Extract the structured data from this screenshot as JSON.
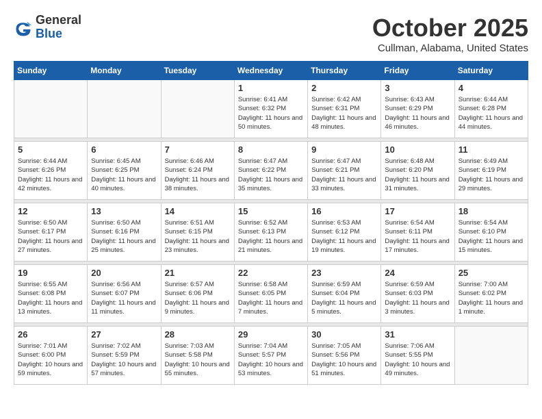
{
  "header": {
    "logo_general": "General",
    "logo_blue": "Blue",
    "month": "October 2025",
    "location": "Cullman, Alabama, United States"
  },
  "weekdays": [
    "Sunday",
    "Monday",
    "Tuesday",
    "Wednesday",
    "Thursday",
    "Friday",
    "Saturday"
  ],
  "weeks": [
    [
      {
        "day": "",
        "detail": ""
      },
      {
        "day": "",
        "detail": ""
      },
      {
        "day": "",
        "detail": ""
      },
      {
        "day": "1",
        "detail": "Sunrise: 6:41 AM\nSunset: 6:32 PM\nDaylight: 11 hours\nand 50 minutes."
      },
      {
        "day": "2",
        "detail": "Sunrise: 6:42 AM\nSunset: 6:31 PM\nDaylight: 11 hours\nand 48 minutes."
      },
      {
        "day": "3",
        "detail": "Sunrise: 6:43 AM\nSunset: 6:29 PM\nDaylight: 11 hours\nand 46 minutes."
      },
      {
        "day": "4",
        "detail": "Sunrise: 6:44 AM\nSunset: 6:28 PM\nDaylight: 11 hours\nand 44 minutes."
      }
    ],
    [
      {
        "day": "5",
        "detail": "Sunrise: 6:44 AM\nSunset: 6:26 PM\nDaylight: 11 hours\nand 42 minutes."
      },
      {
        "day": "6",
        "detail": "Sunrise: 6:45 AM\nSunset: 6:25 PM\nDaylight: 11 hours\nand 40 minutes."
      },
      {
        "day": "7",
        "detail": "Sunrise: 6:46 AM\nSunset: 6:24 PM\nDaylight: 11 hours\nand 38 minutes."
      },
      {
        "day": "8",
        "detail": "Sunrise: 6:47 AM\nSunset: 6:22 PM\nDaylight: 11 hours\nand 35 minutes."
      },
      {
        "day": "9",
        "detail": "Sunrise: 6:47 AM\nSunset: 6:21 PM\nDaylight: 11 hours\nand 33 minutes."
      },
      {
        "day": "10",
        "detail": "Sunrise: 6:48 AM\nSunset: 6:20 PM\nDaylight: 11 hours\nand 31 minutes."
      },
      {
        "day": "11",
        "detail": "Sunrise: 6:49 AM\nSunset: 6:19 PM\nDaylight: 11 hours\nand 29 minutes."
      }
    ],
    [
      {
        "day": "12",
        "detail": "Sunrise: 6:50 AM\nSunset: 6:17 PM\nDaylight: 11 hours\nand 27 minutes."
      },
      {
        "day": "13",
        "detail": "Sunrise: 6:50 AM\nSunset: 6:16 PM\nDaylight: 11 hours\nand 25 minutes."
      },
      {
        "day": "14",
        "detail": "Sunrise: 6:51 AM\nSunset: 6:15 PM\nDaylight: 11 hours\nand 23 minutes."
      },
      {
        "day": "15",
        "detail": "Sunrise: 6:52 AM\nSunset: 6:13 PM\nDaylight: 11 hours\nand 21 minutes."
      },
      {
        "day": "16",
        "detail": "Sunrise: 6:53 AM\nSunset: 6:12 PM\nDaylight: 11 hours\nand 19 minutes."
      },
      {
        "day": "17",
        "detail": "Sunrise: 6:54 AM\nSunset: 6:11 PM\nDaylight: 11 hours\nand 17 minutes."
      },
      {
        "day": "18",
        "detail": "Sunrise: 6:54 AM\nSunset: 6:10 PM\nDaylight: 11 hours\nand 15 minutes."
      }
    ],
    [
      {
        "day": "19",
        "detail": "Sunrise: 6:55 AM\nSunset: 6:08 PM\nDaylight: 11 hours\nand 13 minutes."
      },
      {
        "day": "20",
        "detail": "Sunrise: 6:56 AM\nSunset: 6:07 PM\nDaylight: 11 hours\nand 11 minutes."
      },
      {
        "day": "21",
        "detail": "Sunrise: 6:57 AM\nSunset: 6:06 PM\nDaylight: 11 hours\nand 9 minutes."
      },
      {
        "day": "22",
        "detail": "Sunrise: 6:58 AM\nSunset: 6:05 PM\nDaylight: 11 hours\nand 7 minutes."
      },
      {
        "day": "23",
        "detail": "Sunrise: 6:59 AM\nSunset: 6:04 PM\nDaylight: 11 hours\nand 5 minutes."
      },
      {
        "day": "24",
        "detail": "Sunrise: 6:59 AM\nSunset: 6:03 PM\nDaylight: 11 hours\nand 3 minutes."
      },
      {
        "day": "25",
        "detail": "Sunrise: 7:00 AM\nSunset: 6:02 PM\nDaylight: 11 hours\nand 1 minute."
      }
    ],
    [
      {
        "day": "26",
        "detail": "Sunrise: 7:01 AM\nSunset: 6:00 PM\nDaylight: 10 hours\nand 59 minutes."
      },
      {
        "day": "27",
        "detail": "Sunrise: 7:02 AM\nSunset: 5:59 PM\nDaylight: 10 hours\nand 57 minutes."
      },
      {
        "day": "28",
        "detail": "Sunrise: 7:03 AM\nSunset: 5:58 PM\nDaylight: 10 hours\nand 55 minutes."
      },
      {
        "day": "29",
        "detail": "Sunrise: 7:04 AM\nSunset: 5:57 PM\nDaylight: 10 hours\nand 53 minutes."
      },
      {
        "day": "30",
        "detail": "Sunrise: 7:05 AM\nSunset: 5:56 PM\nDaylight: 10 hours\nand 51 minutes."
      },
      {
        "day": "31",
        "detail": "Sunrise: 7:06 AM\nSunset: 5:55 PM\nDaylight: 10 hours\nand 49 minutes."
      },
      {
        "day": "",
        "detail": ""
      }
    ]
  ]
}
